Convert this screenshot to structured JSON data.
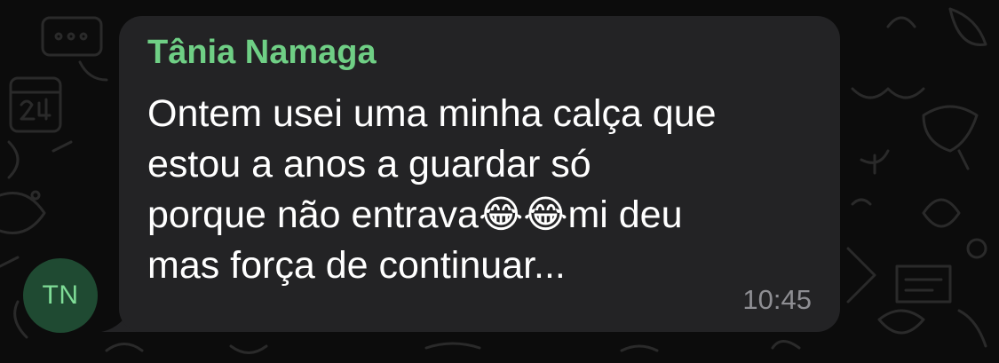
{
  "chat": {
    "message": {
      "sender": "Tânia Namaga",
      "text": "Ontem usei uma minha calça que\nestou a anos a guardar só\nporque não entrava😂😂mi deu\nmas força de continuar...",
      "time": "10:45"
    },
    "avatar": {
      "initials": "TN"
    }
  },
  "colors": {
    "background": "#0c0c0c",
    "bubble": "#232325",
    "sender_name": "#6fcf85",
    "message_text": "#ffffff",
    "timestamp": "#8e8e93",
    "avatar_bg": "#1f4a32",
    "avatar_text": "#7fdc97"
  }
}
